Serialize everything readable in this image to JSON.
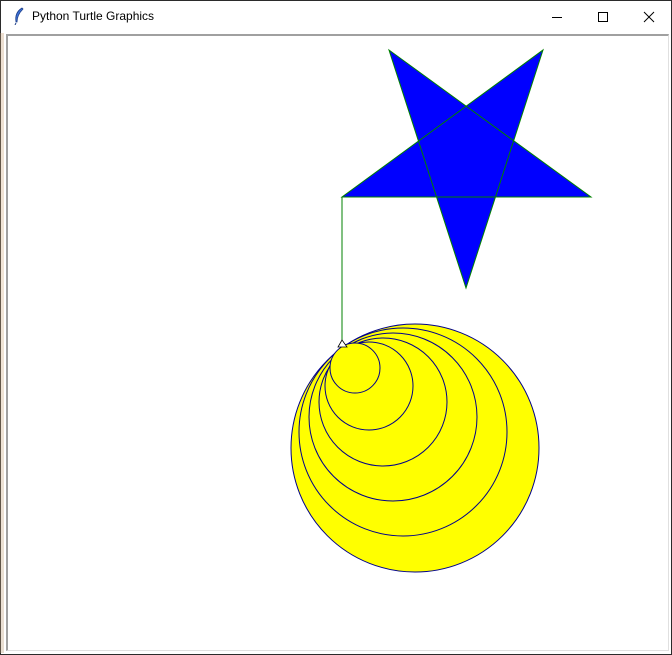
{
  "window": {
    "title": "Python Turtle Graphics",
    "app_icon": "feather-icon",
    "controls": {
      "minimize_icon": "minimize-icon",
      "maximize_icon": "maximize-icon",
      "close_icon": "close-icon"
    }
  },
  "drawing": {
    "star": {
      "fill": "#0000ff",
      "outline": "#008000"
    },
    "circles": {
      "count": 6,
      "fill": "#ffff00",
      "outline": "#00008b"
    },
    "connector_color": "#008000",
    "turtle_cursor": "arrow-cursor-icon"
  }
}
